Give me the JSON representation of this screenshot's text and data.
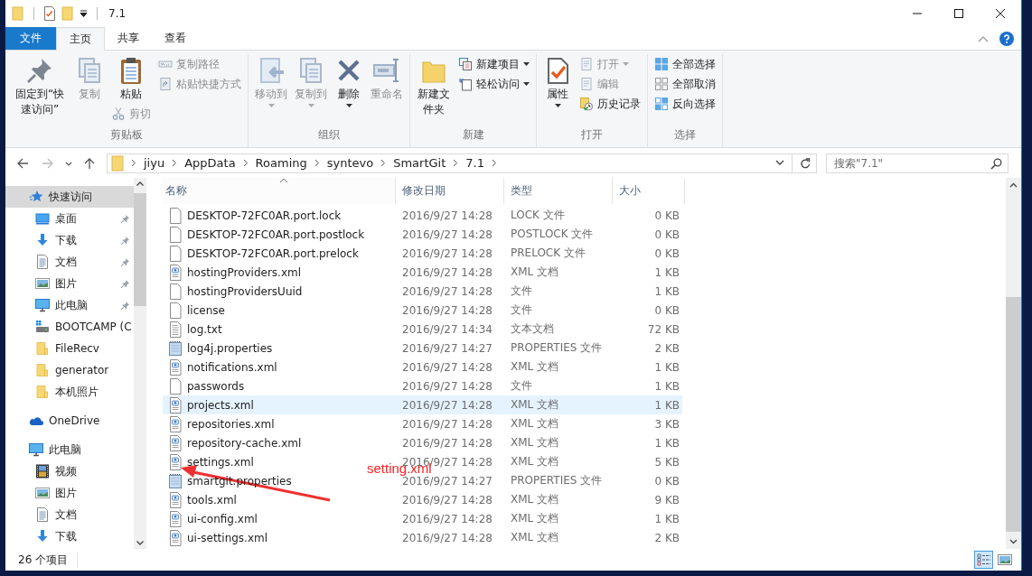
{
  "window": {
    "title": "7.1",
    "quick_access": [
      {
        "kind": "folder"
      },
      {
        "kind": "properties"
      },
      {
        "kind": "new-folder"
      },
      {
        "kind": "customize"
      }
    ]
  },
  "ribbon": {
    "tabs": [
      {
        "label": "文件",
        "kind": "file-menu",
        "selected": false
      },
      {
        "label": "主页",
        "kind": "tab",
        "selected": true
      },
      {
        "label": "共享",
        "kind": "tab",
        "selected": false
      },
      {
        "label": "查看",
        "kind": "tab",
        "selected": false
      }
    ],
    "groups": [
      {
        "label": "剪贴板",
        "columns": [
          [
            {
              "label": "固定到“快速访问”",
              "kind": "pin",
              "disabled": false,
              "menu": false
            }
          ],
          [
            {
              "label": "复制",
              "kind": "copy",
              "disabled": true,
              "menu": false
            }
          ],
          [
            {
              "label": "粘贴",
              "kind": "paste",
              "disabled": false,
              "menu": false
            },
            {
              "label": "剪切",
              "kind": "cut",
              "disabled": true,
              "menu": false
            }
          ],
          [
            {
              "label": "复制路径",
              "kind": "copy-path",
              "disabled": true,
              "menu": false
            },
            {
              "label": "粘贴快捷方式",
              "kind": "paste-shortcut",
              "disabled": true,
              "menu": false
            }
          ]
        ]
      },
      {
        "label": "组织",
        "columns": [
          [
            {
              "label": "移动到",
              "kind": "move-to",
              "disabled": true,
              "menu": true
            }
          ],
          [
            {
              "label": "复制到",
              "kind": "copy-to",
              "disabled": true,
              "menu": true
            }
          ],
          [
            {
              "label": "删除",
              "kind": "delete",
              "disabled": false,
              "menu": true
            }
          ],
          [
            {
              "label": "重命名",
              "kind": "rename",
              "disabled": true,
              "menu": false
            }
          ]
        ]
      },
      {
        "label": "新建",
        "columns": [
          [
            {
              "label": "新建文件夹",
              "kind": "new-folder",
              "disabled": false,
              "menu": false
            }
          ],
          [
            {
              "label": "新建项目",
              "kind": "new-item",
              "disabled": false,
              "menu": true
            },
            {
              "label": "轻松访问",
              "kind": "easy-access",
              "disabled": false,
              "menu": true
            }
          ]
        ]
      },
      {
        "label": "打开",
        "columns": [
          [
            {
              "label": "属性",
              "kind": "properties",
              "disabled": false,
              "menu": true
            }
          ],
          [
            {
              "label": "打开",
              "kind": "open",
              "disabled": true,
              "menu": true
            },
            {
              "label": "编辑",
              "kind": "edit",
              "disabled": true,
              "menu": false
            },
            {
              "label": "历史记录",
              "kind": "history",
              "disabled": false,
              "menu": false
            }
          ]
        ]
      },
      {
        "label": "选择",
        "columns": [
          [
            {
              "label": "全部选择",
              "kind": "select-all",
              "disabled": false,
              "menu": false
            },
            {
              "label": "全部取消",
              "kind": "select-none",
              "disabled": false,
              "menu": false
            },
            {
              "label": "反向选择",
              "kind": "invert-selection",
              "disabled": false,
              "menu": false
            }
          ]
        ]
      }
    ]
  },
  "address_bar": {
    "nav_buttons": [
      {
        "kind": "back",
        "disabled": false
      },
      {
        "kind": "forward",
        "disabled": true
      },
      {
        "kind": "recent",
        "disabled": false
      },
      {
        "kind": "up",
        "disabled": false
      }
    ],
    "segments": [
      "jiyu",
      "AppData",
      "Roaming",
      "syntevo",
      "SmartGit",
      "7.1"
    ]
  },
  "search": {
    "placeholder": "搜索\"7.1\""
  },
  "navigation": {
    "items": [
      {
        "label": "快速访问",
        "kind": "star",
        "selected": true,
        "children": [
          {
            "label": "桌面",
            "kind": "desktop",
            "selected": false,
            "pinned": true
          },
          {
            "label": "下载",
            "kind": "download",
            "selected": false,
            "pinned": true
          },
          {
            "label": "文档",
            "kind": "document",
            "selected": false,
            "pinned": true
          },
          {
            "label": "图片",
            "kind": "pictures",
            "selected": false,
            "pinned": true
          },
          {
            "label": "此电脑",
            "kind": "computer",
            "selected": false,
            "pinned": true
          },
          {
            "label": "BOOTCAMP (C",
            "kind": "drive",
            "selected": false,
            "pinned": false
          },
          {
            "label": "FileRecv",
            "kind": "folder",
            "selected": false,
            "pinned": false
          },
          {
            "label": "generator",
            "kind": "folder",
            "selected": false,
            "pinned": false
          },
          {
            "label": "本机照片",
            "kind": "folder",
            "selected": false,
            "pinned": false
          }
        ]
      },
      {
        "label": "OneDrive",
        "kind": "cloud",
        "selected": false
      },
      {
        "label": "此电脑",
        "kind": "computer",
        "selected": false,
        "children": [
          {
            "label": "视频",
            "kind": "video",
            "selected": false
          },
          {
            "label": "图片",
            "kind": "pictures",
            "selected": false
          },
          {
            "label": "文档",
            "kind": "document",
            "selected": false
          },
          {
            "label": "下载",
            "kind": "download",
            "selected": false
          }
        ]
      }
    ]
  },
  "file_list": {
    "columns": [
      {
        "label": "名称",
        "sorted": true
      },
      {
        "label": "修改日期",
        "sorted": false
      },
      {
        "label": "类型",
        "sorted": false
      },
      {
        "label": "大小",
        "sorted": false
      }
    ],
    "rows": [
      {
        "name": "DESKTOP-72FC0AR.port.lock",
        "date": "2016/9/27 14:28",
        "type": "LOCK 文件",
        "size": "0 KB",
        "kind": "blank",
        "selected": false
      },
      {
        "name": "DESKTOP-72FC0AR.port.postlock",
        "date": "2016/9/27 14:28",
        "type": "POSTLOCK 文件",
        "size": "0 KB",
        "kind": "blank",
        "selected": false
      },
      {
        "name": "DESKTOP-72FC0AR.port.prelock",
        "date": "2016/9/27 14:28",
        "type": "PRELOCK 文件",
        "size": "0 KB",
        "kind": "blank",
        "selected": false
      },
      {
        "name": "hostingProviders.xml",
        "date": "2016/9/27 14:28",
        "type": "XML 文档",
        "size": "1 KB",
        "kind": "xml",
        "selected": false
      },
      {
        "name": "hostingProvidersUuid",
        "date": "2016/9/27 14:28",
        "type": "文件",
        "size": "1 KB",
        "kind": "blank",
        "selected": false
      },
      {
        "name": "license",
        "date": "2016/9/27 14:28",
        "type": "文件",
        "size": "0 KB",
        "kind": "blank",
        "selected": false
      },
      {
        "name": "log.txt",
        "date": "2016/9/27 14:34",
        "type": "文本文档",
        "size": "72 KB",
        "kind": "text",
        "selected": false
      },
      {
        "name": "log4j.properties",
        "date": "2016/9/27 14:27",
        "type": "PROPERTIES 文件",
        "size": "2 KB",
        "kind": "properties",
        "selected": false
      },
      {
        "name": "notifications.xml",
        "date": "2016/9/27 14:28",
        "type": "XML 文档",
        "size": "1 KB",
        "kind": "xml",
        "selected": false
      },
      {
        "name": "passwords",
        "date": "2016/9/27 14:28",
        "type": "文件",
        "size": "1 KB",
        "kind": "blank",
        "selected": false
      },
      {
        "name": "projects.xml",
        "date": "2016/9/27 14:28",
        "type": "XML 文档",
        "size": "1 KB",
        "kind": "xml",
        "selected": true
      },
      {
        "name": "repositories.xml",
        "date": "2016/9/27 14:28",
        "type": "XML 文档",
        "size": "3 KB",
        "kind": "xml",
        "selected": false
      },
      {
        "name": "repository-cache.xml",
        "date": "2016/9/27 14:28",
        "type": "XML 文档",
        "size": "1 KB",
        "kind": "xml",
        "selected": false
      },
      {
        "name": "settings.xml",
        "date": "2016/9/27 14:28",
        "type": "XML 文档",
        "size": "5 KB",
        "kind": "xml",
        "selected": false
      },
      {
        "name": "smartgit.properties",
        "date": "2016/9/27 14:27",
        "type": "PROPERTIES 文件",
        "size": "0 KB",
        "kind": "properties",
        "selected": false
      },
      {
        "name": "tools.xml",
        "date": "2016/9/27 14:28",
        "type": "XML 文档",
        "size": "9 KB",
        "kind": "xml",
        "selected": false
      },
      {
        "name": "ui-config.xml",
        "date": "2016/9/27 14:28",
        "type": "XML 文档",
        "size": "1 KB",
        "kind": "xml",
        "selected": false
      },
      {
        "name": "ui-settings.xml",
        "date": "2016/9/27 14:28",
        "type": "XML 文档",
        "size": "2 KB",
        "kind": "xml",
        "selected": false
      }
    ]
  },
  "annotations": [
    {
      "kind": "arrow-label",
      "text": "setting.xml"
    }
  ],
  "status_bar": {
    "item_count": "26 个项目",
    "view_buttons": [
      {
        "kind": "details",
        "selected": true
      },
      {
        "kind": "large-icons",
        "selected": false
      }
    ]
  }
}
